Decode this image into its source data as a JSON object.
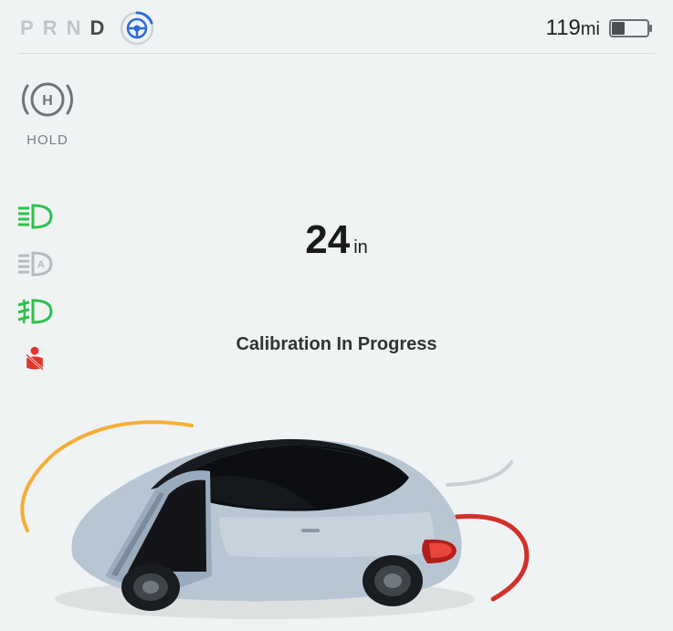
{
  "gear": {
    "p": "P",
    "r": "R",
    "n": "N",
    "d": "D",
    "active": "D"
  },
  "range": {
    "value": "119",
    "unit": "mi"
  },
  "battery": {
    "percent": 35
  },
  "hold": {
    "label": "HOLD"
  },
  "distance": {
    "value": "24",
    "unit": "in"
  },
  "status": {
    "message": "Calibration In Progress"
  },
  "indicators": {
    "headlight_high": true,
    "headlight_auto": false,
    "foglight": true,
    "seatbelt": true
  }
}
